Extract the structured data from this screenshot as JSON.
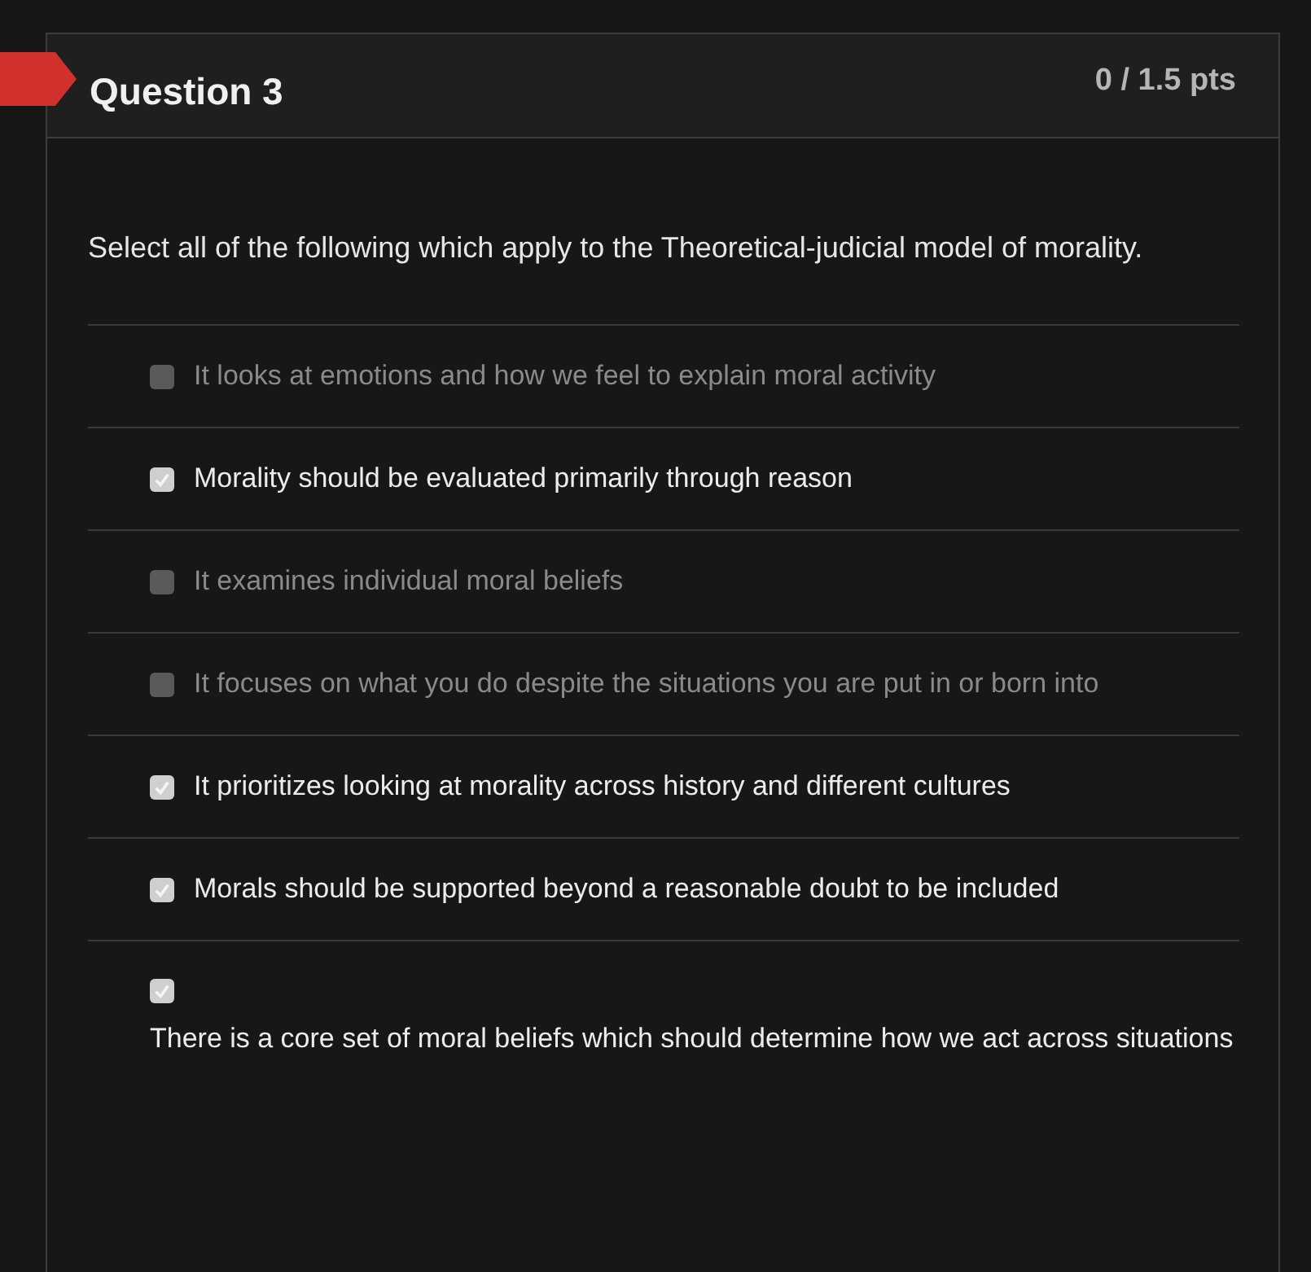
{
  "question": {
    "title": "Question 3",
    "points": "0 / 1.5 pts",
    "flagged": true
  },
  "prompt": "Select all of the following which apply to the Theoretical-judicial model of morality.",
  "options": [
    {
      "kind": "inline",
      "label": "It looks at emotions and how we feel to explain moral activity",
      "checked": false
    },
    {
      "kind": "inline",
      "label": "Morality should be evaluated primarily through reason",
      "checked": true
    },
    {
      "kind": "inline",
      "label": "It examines individual moral beliefs",
      "checked": false
    },
    {
      "kind": "inline",
      "label": "It focuses on what you do despite the situations you are put in or born into",
      "checked": false
    },
    {
      "kind": "inline",
      "label": "It prioritizes looking at morality across history and different cultures",
      "checked": true
    },
    {
      "kind": "inline",
      "label": "Morals should be supported beyond a reasonable doubt to be included",
      "checked": true
    },
    {
      "kind": "stacked",
      "label": "There is a core set of moral beliefs which should determine how we act across situations",
      "checked": true
    }
  ]
}
